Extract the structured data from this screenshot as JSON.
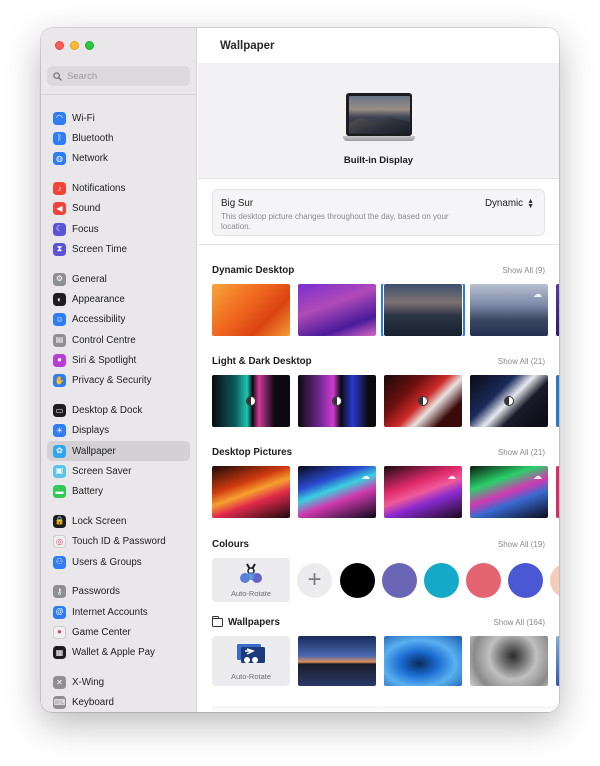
{
  "window": {
    "title": "Wallpaper"
  },
  "search": {
    "placeholder": "Search"
  },
  "sidebar": {
    "groups": [
      [
        {
          "label": "Wi-Fi",
          "icon": "wifi-icon",
          "color": "#2f7cf6"
        },
        {
          "label": "Bluetooth",
          "icon": "bluetooth-icon",
          "color": "#2f7cf6"
        },
        {
          "label": "Network",
          "icon": "globe-icon",
          "color": "#2f7cf6"
        }
      ],
      [
        {
          "label": "Notifications",
          "icon": "bell-icon",
          "color": "#f0443a"
        },
        {
          "label": "Sound",
          "icon": "speaker-icon",
          "color": "#f0443a"
        },
        {
          "label": "Focus",
          "icon": "moon-icon",
          "color": "#5a53d6"
        },
        {
          "label": "Screen Time",
          "icon": "hourglass-icon",
          "color": "#5a53d6"
        }
      ],
      [
        {
          "label": "General",
          "icon": "gear-icon",
          "color": "#8e8e93"
        },
        {
          "label": "Appearance",
          "icon": "appearance-icon",
          "color": "#1d1d1f"
        },
        {
          "label": "Accessibility",
          "icon": "accessibility-icon",
          "color": "#2f7cf6"
        },
        {
          "label": "Control Centre",
          "icon": "control-centre-icon",
          "color": "#8e8e93"
        },
        {
          "label": "Siri & Spotlight",
          "icon": "siri-icon",
          "color": "#b83fd6"
        },
        {
          "label": "Privacy & Security",
          "icon": "hand-icon",
          "color": "#2f7cf6"
        }
      ],
      [
        {
          "label": "Desktop & Dock",
          "icon": "dock-icon",
          "color": "#1d1d1f"
        },
        {
          "label": "Displays",
          "icon": "sun-icon",
          "color": "#2f7cf6"
        },
        {
          "label": "Wallpaper",
          "icon": "wallpaper-icon",
          "color": "#33a6f0",
          "active": true
        },
        {
          "label": "Screen Saver",
          "icon": "screen-saver-icon",
          "color": "#5cc4e8"
        },
        {
          "label": "Battery",
          "icon": "battery-icon",
          "color": "#34c759"
        }
      ],
      [
        {
          "label": "Lock Screen",
          "icon": "lock-icon",
          "color": "#1d1d1f"
        },
        {
          "label": "Touch ID & Password",
          "icon": "fingerprint-icon",
          "color": "#f0f0f0"
        },
        {
          "label": "Users & Groups",
          "icon": "users-icon",
          "color": "#2f7cf6"
        }
      ],
      [
        {
          "label": "Passwords",
          "icon": "key-icon",
          "color": "#8e8e93"
        },
        {
          "label": "Internet Accounts",
          "icon": "at-icon",
          "color": "#2f7cf6"
        },
        {
          "label": "Game Center",
          "icon": "game-center-icon",
          "color": "#f0f0f0"
        },
        {
          "label": "Wallet & Apple Pay",
          "icon": "wallet-icon",
          "color": "#1d1d1f"
        }
      ],
      [
        {
          "label": "X-Wing",
          "icon": "xwing-icon",
          "color": "#8e8e93"
        },
        {
          "label": "Keyboard",
          "icon": "keyboard-icon",
          "color": "#8e8e93"
        }
      ]
    ]
  },
  "display": {
    "label": "Built-in Display"
  },
  "selected": {
    "name": "Big Sur",
    "description": "This desktop picture changes throughout the day, based on your location.",
    "mode": "Dynamic"
  },
  "sections": {
    "dynamic": {
      "title": "Dynamic Desktop",
      "show_all": "Show All (9)"
    },
    "light_dark": {
      "title": "Light & Dark Desktop",
      "show_all": "Show All (21)"
    },
    "pictures": {
      "title": "Desktop Pictures",
      "show_all": "Show All (21)"
    },
    "colours": {
      "title": "Colours",
      "show_all": "Show All (19)",
      "auto_label": "Auto-Rotate",
      "swatches": [
        "#000000",
        "#6b65b5",
        "#14a9c9",
        "#e56472",
        "#4a58d4",
        "#f6cbb8"
      ]
    },
    "wallpapers": {
      "title": "Wallpapers",
      "show_all": "Show All (164)",
      "auto_label": "Auto-Rotate"
    }
  }
}
